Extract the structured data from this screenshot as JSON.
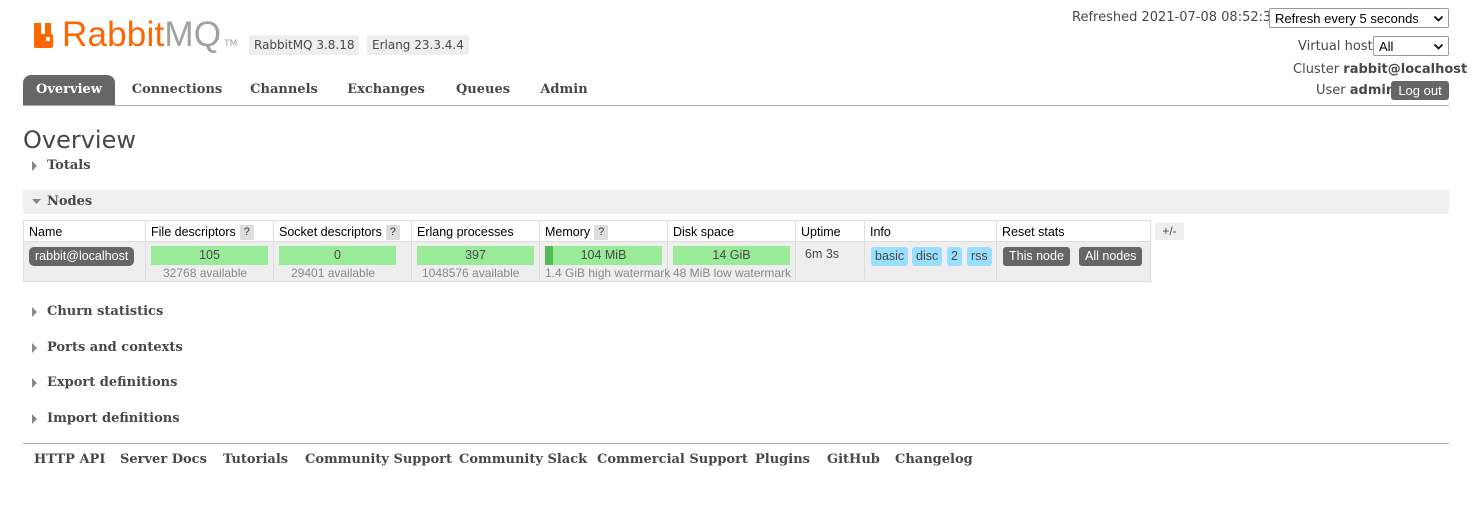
{
  "brand": {
    "name_a": "Rabbit",
    "name_b": "MQ",
    "tm": "TM",
    "accent": "#ff6600"
  },
  "versions": {
    "rabbitmq": "RabbitMQ 3.8.18",
    "erlang": "Erlang 23.3.4.4"
  },
  "topbar": {
    "refreshed_label": "Refreshed 2021-07-08 08:52:35",
    "refresh_select": "Refresh every 5 seconds",
    "vhost_label": "Virtual host",
    "vhost_select": "All",
    "cluster_label": "Cluster",
    "cluster_value": "rabbit@localhost",
    "user_label": "User",
    "user_value": "admin",
    "logout": "Log out"
  },
  "tabs": [
    "Overview",
    "Connections",
    "Channels",
    "Exchanges",
    "Queues",
    "Admin"
  ],
  "page_title": "Overview",
  "sections": {
    "totals": "Totals",
    "nodes": "Nodes",
    "churn": "Churn statistics",
    "ports": "Ports and contexts",
    "export": "Export definitions",
    "import": "Import definitions"
  },
  "nodes_table": {
    "headers": {
      "name": "Name",
      "fd": "File descriptors",
      "sd": "Socket descriptors",
      "ep": "Erlang processes",
      "mem": "Memory",
      "disk": "Disk space",
      "uptime": "Uptime",
      "info": "Info",
      "reset": "Reset stats",
      "help": "?"
    },
    "row": {
      "name": "rabbit@localhost",
      "fd_value": "105",
      "fd_sub": "32768 available",
      "sd_value": "0",
      "sd_sub": "29401 available",
      "ep_value": "397",
      "ep_sub": "1048576 available",
      "mem_value": "104 MiB",
      "mem_sub": "1.4 GiB high watermark",
      "mem_fraction": 0.07,
      "disk_value": "14 GiB",
      "disk_sub": "48 MiB low watermark",
      "uptime": "6m 3s",
      "info_badges": [
        "basic",
        "disc",
        "2",
        "rss"
      ],
      "reset_this": "This node",
      "reset_all": "All nodes"
    },
    "column_toggle": "+/-"
  },
  "footer": [
    "HTTP API",
    "Server Docs",
    "Tutorials",
    "Community Support",
    "Community Slack",
    "Commercial Support",
    "Plugins",
    "GitHub",
    "Changelog"
  ]
}
